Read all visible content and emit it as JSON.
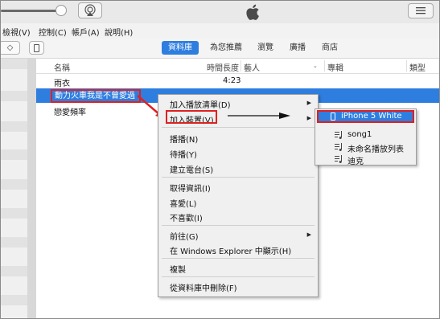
{
  "menubar": {
    "items": [
      "檢視(V)",
      "控制(C)",
      "帳戶(A)",
      "說明(H)"
    ]
  },
  "navbar": {
    "back": "◇",
    "tabs": [
      {
        "label": "資料庫",
        "active": true
      },
      {
        "label": "為您推薦",
        "active": false
      },
      {
        "label": "瀏覽",
        "active": false
      },
      {
        "label": "廣播",
        "active": false
      },
      {
        "label": "商店",
        "active": false
      }
    ]
  },
  "table": {
    "headers": {
      "name": "名稱",
      "time": "時間長度",
      "artist": "藝人",
      "album": "專輯",
      "genre": "類型"
    },
    "rows": [
      {
        "name": "雨衣",
        "time": "4:23",
        "selected": false
      },
      {
        "name": "動力火車我是不曾愛過",
        "time": "",
        "selected": true
      },
      {
        "name": "戀愛頻率",
        "time": "",
        "selected": false
      }
    ]
  },
  "context_menu": {
    "items": {
      "add_to_playlist": "加入播放清單(D)",
      "add_to_device": "加入裝置(V)",
      "play": "播播(N)",
      "play_next": "待播(Y)",
      "create_station": "建立電台(S)",
      "get_info": "取得資訊(I)",
      "love": "喜愛(L)",
      "dislike": "不喜歡(I)",
      "go_to": "前往(G)",
      "show_in_explorer": "在 Windows Explorer 中顯示(H)",
      "copy": "複製",
      "delete_from_library": "從資料庫中刪除(F)"
    },
    "submenu_arrow": "▶"
  },
  "device_submenu": {
    "items": [
      "iPhone 5 White",
      "song1",
      "未命名播放列表",
      "迪克"
    ]
  },
  "colors": {
    "accent": "#2e7ee0",
    "highlight_box": "#e02020"
  },
  "icons": [
    "apple-logo-icon",
    "airplay-icon",
    "list-view-icon",
    "phone-icon",
    "playlist-icon"
  ]
}
